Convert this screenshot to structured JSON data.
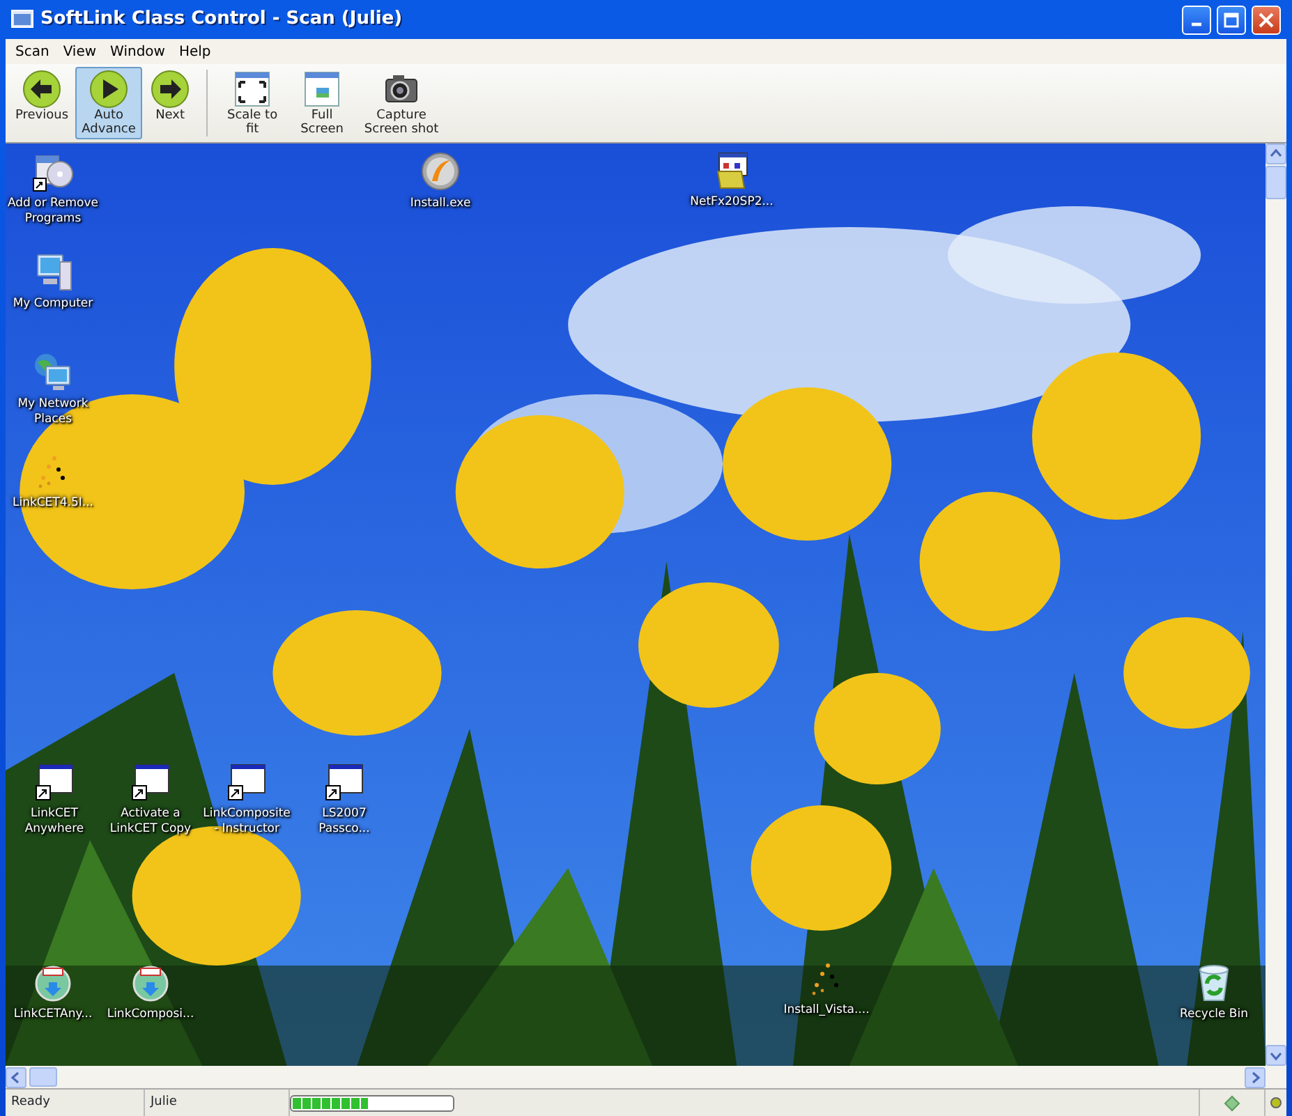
{
  "window": {
    "title": "SoftLink Class Control - Scan (Julie)"
  },
  "menu": [
    "Scan",
    "View",
    "Window",
    "Help"
  ],
  "toolbar": [
    {
      "kind": "previous",
      "label": "Previous",
      "selected": false
    },
    {
      "kind": "auto",
      "label": "Auto Advance",
      "selected": true
    },
    {
      "kind": "next",
      "label": "Next",
      "selected": false
    },
    {
      "kind": "scale",
      "label": "Scale to fit",
      "selected": false
    },
    {
      "kind": "full",
      "label": "Full Screen",
      "selected": false
    },
    {
      "kind": "camera",
      "label": "Capture Screen shot",
      "selected": false
    }
  ],
  "desktop": {
    "icons": [
      {
        "kind": "programs",
        "label": "Add or Remove Programs"
      },
      {
        "kind": "computer",
        "label": "My Computer"
      },
      {
        "kind": "network",
        "label": "My Network Places"
      },
      {
        "kind": "spinner",
        "label": "LinkCET4.5I..."
      },
      {
        "kind": "install",
        "label": "Install.exe"
      },
      {
        "kind": "package",
        "label": "NetFx20SP2..."
      },
      {
        "kind": "window",
        "label": "LinkCET Anywhere"
      },
      {
        "kind": "window",
        "label": "Activate a LinkCET Copy"
      },
      {
        "kind": "window",
        "label": "LinkComposite - Instructor"
      },
      {
        "kind": "window",
        "label": "LS2007 Passco..."
      },
      {
        "kind": "disc",
        "label": "LinkCETAny..."
      },
      {
        "kind": "disc",
        "label": "LinkComposi..."
      },
      {
        "kind": "spinner",
        "label": "Install_Vista...."
      },
      {
        "kind": "recycle",
        "label": "Recycle Bin"
      }
    ]
  },
  "status_bar": {
    "status": "Ready",
    "user": "Julie",
    "progress": {
      "level": 0.47
    }
  }
}
